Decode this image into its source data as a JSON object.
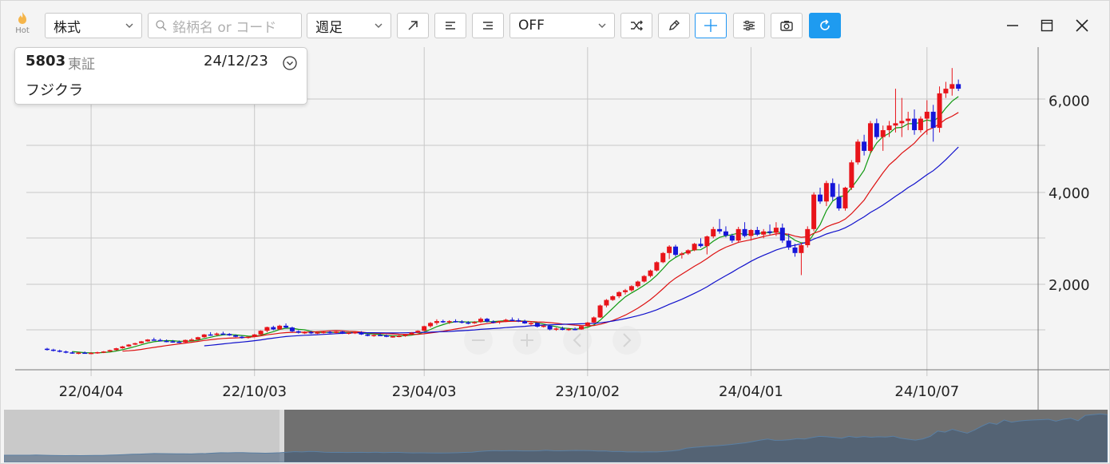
{
  "toolbar": {
    "hot_label": "Hot",
    "asset_type": "株式",
    "search_placeholder": "銘柄名 or コード",
    "period": "週足",
    "indicator_select": "OFF"
  },
  "info": {
    "code": "5803",
    "market": "東証",
    "date": "24/12/23",
    "name": "フジクラ"
  },
  "colors": {
    "up": "#e8141a",
    "down": "#1616d9",
    "ma_short": "#119911",
    "ma_mid": "#dd1111",
    "ma_long": "#1111cc",
    "accent": "#1e9bf0"
  },
  "chart_data": {
    "type": "candlestick",
    "x_ticks": [
      "22/04/04",
      "22/10/03",
      "23/04/03",
      "23/10/02",
      "24/04/01",
      "24/10/07"
    ],
    "y_ticks": [
      "2,000",
      "4,000",
      "6,000"
    ],
    "y_tick_values": [
      2000,
      4000,
      6000
    ],
    "ylim": [
      -800,
      7000
    ],
    "grid": true,
    "weeks_total": 152,
    "candles": [
      [
        600,
        620,
        560,
        580
      ],
      [
        580,
        600,
        540,
        555
      ],
      [
        560,
        580,
        520,
        535
      ],
      [
        540,
        560,
        500,
        520
      ],
      [
        520,
        540,
        490,
        505
      ],
      [
        505,
        530,
        480,
        515
      ],
      [
        515,
        540,
        495,
        500
      ],
      [
        500,
        525,
        480,
        510
      ],
      [
        510,
        535,
        490,
        525
      ],
      [
        525,
        550,
        505,
        540
      ],
      [
        540,
        580,
        530,
        570
      ],
      [
        570,
        620,
        560,
        610
      ],
      [
        610,
        660,
        600,
        650
      ],
      [
        650,
        700,
        640,
        690
      ],
      [
        690,
        730,
        680,
        720
      ],
      [
        720,
        770,
        710,
        760
      ],
      [
        760,
        810,
        750,
        800
      ],
      [
        800,
        840,
        780,
        790
      ],
      [
        790,
        820,
        760,
        770
      ],
      [
        770,
        800,
        740,
        760
      ],
      [
        760,
        790,
        730,
        750
      ],
      [
        750,
        780,
        720,
        740
      ],
      [
        740,
        800,
        730,
        790
      ],
      [
        790,
        830,
        770,
        800
      ],
      [
        800,
        860,
        790,
        850
      ],
      [
        850,
        920,
        840,
        910
      ],
      [
        910,
        960,
        880,
        900
      ],
      [
        900,
        950,
        880,
        930
      ],
      [
        930,
        970,
        900,
        920
      ],
      [
        920,
        940,
        880,
        890
      ],
      [
        890,
        910,
        850,
        860
      ],
      [
        860,
        880,
        820,
        840
      ],
      [
        840,
        870,
        820,
        860
      ],
      [
        860,
        920,
        850,
        910
      ],
      [
        910,
        1000,
        900,
        990
      ],
      [
        990,
        1080,
        960,
        1070
      ],
      [
        1070,
        1100,
        1000,
        1020
      ],
      [
        1020,
        1120,
        1010,
        1100
      ],
      [
        1100,
        1150,
        1040,
        1060
      ],
      [
        1060,
        1080,
        960,
        980
      ],
      [
        980,
        1000,
        930,
        950
      ],
      [
        950,
        980,
        920,
        960
      ],
      [
        960,
        990,
        920,
        940
      ],
      [
        940,
        970,
        920,
        955
      ],
      [
        955,
        990,
        930,
        965
      ],
      [
        965,
        990,
        930,
        945
      ],
      [
        945,
        980,
        930,
        970
      ],
      [
        970,
        990,
        920,
        930
      ],
      [
        930,
        960,
        910,
        950
      ],
      [
        950,
        980,
        920,
        960
      ],
      [
        960,
        980,
        900,
        910
      ],
      [
        910,
        930,
        870,
        880
      ],
      [
        880,
        910,
        860,
        900
      ],
      [
        900,
        930,
        880,
        890
      ],
      [
        890,
        910,
        850,
        860
      ],
      [
        860,
        890,
        840,
        870
      ],
      [
        870,
        900,
        850,
        880
      ],
      [
        880,
        920,
        860,
        910
      ],
      [
        910,
        960,
        900,
        950
      ],
      [
        950,
        1000,
        940,
        990
      ],
      [
        990,
        1100,
        980,
        1090
      ],
      [
        1090,
        1180,
        1060,
        1160
      ],
      [
        1160,
        1240,
        1120,
        1200
      ],
      [
        1200,
        1230,
        1160,
        1180
      ],
      [
        1180,
        1220,
        1140,
        1200
      ],
      [
        1200,
        1240,
        1170,
        1190
      ],
      [
        1190,
        1220,
        1150,
        1170
      ],
      [
        1170,
        1200,
        1130,
        1160
      ],
      [
        1160,
        1200,
        1140,
        1180
      ],
      [
        1180,
        1280,
        1160,
        1250
      ],
      [
        1250,
        1270,
        1170,
        1190
      ],
      [
        1190,
        1220,
        1150,
        1180
      ],
      [
        1180,
        1210,
        1140,
        1200
      ],
      [
        1200,
        1250,
        1180,
        1230
      ],
      [
        1230,
        1280,
        1200,
        1220
      ],
      [
        1220,
        1260,
        1180,
        1200
      ],
      [
        1200,
        1230,
        1140,
        1150
      ],
      [
        1150,
        1180,
        1100,
        1160
      ],
      [
        1160,
        1170,
        1060,
        1080
      ],
      [
        1080,
        1120,
        1060,
        1100
      ],
      [
        1100,
        1110,
        1000,
        1020
      ],
      [
        1020,
        1060,
        990,
        1040
      ],
      [
        1040,
        1080,
        1000,
        1010
      ],
      [
        1010,
        1050,
        990,
        1030
      ],
      [
        1030,
        1060,
        1000,
        1020
      ],
      [
        1020,
        1100,
        1010,
        1090
      ],
      [
        1090,
        1180,
        1080,
        1170
      ],
      [
        1170,
        1300,
        1160,
        1280
      ],
      [
        1280,
        1560,
        1270,
        1540
      ],
      [
        1540,
        1680,
        1500,
        1660
      ],
      [
        1660,
        1760,
        1640,
        1740
      ],
      [
        1740,
        1850,
        1700,
        1830
      ],
      [
        1830,
        1900,
        1780,
        1870
      ],
      [
        1870,
        1980,
        1840,
        1960
      ],
      [
        1960,
        2080,
        1930,
        2060
      ],
      [
        2060,
        2200,
        2040,
        2180
      ],
      [
        2180,
        2320,
        2150,
        2300
      ],
      [
        2300,
        2500,
        2280,
        2480
      ],
      [
        2480,
        2700,
        2460,
        2680
      ],
      [
        2680,
        2850,
        2550,
        2820
      ],
      [
        2820,
        2860,
        2600,
        2640
      ],
      [
        2640,
        2700,
        2560,
        2670
      ],
      [
        2670,
        2760,
        2640,
        2740
      ],
      [
        2740,
        2900,
        2720,
        2880
      ],
      [
        2880,
        3000,
        2800,
        2830
      ],
      [
        2830,
        3060,
        2650,
        3040
      ],
      [
        3040,
        3250,
        3000,
        3200
      ],
      [
        3200,
        3420,
        3100,
        3150
      ],
      [
        3150,
        3260,
        3020,
        3060
      ],
      [
        3060,
        3100,
        2900,
        2950
      ],
      [
        2950,
        3250,
        2900,
        3200
      ],
      [
        3200,
        3350,
        3020,
        3050
      ],
      [
        3050,
        3200,
        2950,
        3180
      ],
      [
        3180,
        3250,
        3050,
        3080
      ],
      [
        3080,
        3200,
        3000,
        3150
      ],
      [
        3150,
        3300,
        3080,
        3120
      ],
      [
        3120,
        3350,
        3050,
        3230
      ],
      [
        3230,
        3320,
        2900,
        2950
      ],
      [
        2950,
        3100,
        2750,
        2800
      ],
      [
        2800,
        2880,
        2600,
        2680
      ],
      [
        2680,
        2900,
        2200,
        2850
      ],
      [
        2850,
        3260,
        2800,
        3200
      ],
      [
        3200,
        4000,
        3150,
        3950
      ],
      [
        3950,
        4100,
        3750,
        3800
      ],
      [
        3800,
        4250,
        3700,
        4200
      ],
      [
        4200,
        4300,
        3820,
        3900
      ],
      [
        3900,
        4180,
        3600,
        3650
      ],
      [
        3650,
        4120,
        3600,
        4100
      ],
      [
        4100,
        4700,
        4050,
        4650
      ],
      [
        4650,
        5150,
        4600,
        5100
      ],
      [
        5100,
        5250,
        4800,
        4900
      ],
      [
        4900,
        5550,
        4850,
        5500
      ],
      [
        5500,
        5600,
        5150,
        5200
      ],
      [
        5200,
        5450,
        4900,
        5350
      ],
      [
        5350,
        5550,
        5200,
        5450
      ],
      [
        5450,
        6250,
        5300,
        5500
      ],
      [
        5500,
        6050,
        5200,
        5550
      ],
      [
        5550,
        5750,
        5350,
        5600
      ],
      [
        5600,
        5800,
        5250,
        5350
      ],
      [
        5350,
        5650,
        5300,
        5600
      ],
      [
        5600,
        6000,
        5250,
        5750
      ],
      [
        5750,
        5900,
        5100,
        5400
      ],
      [
        5400,
        6300,
        5300,
        6150
      ],
      [
        6150,
        6400,
        6050,
        6250
      ],
      [
        6250,
        6700,
        6100,
        6350
      ],
      [
        6350,
        6450,
        6200,
        6250
      ]
    ]
  }
}
